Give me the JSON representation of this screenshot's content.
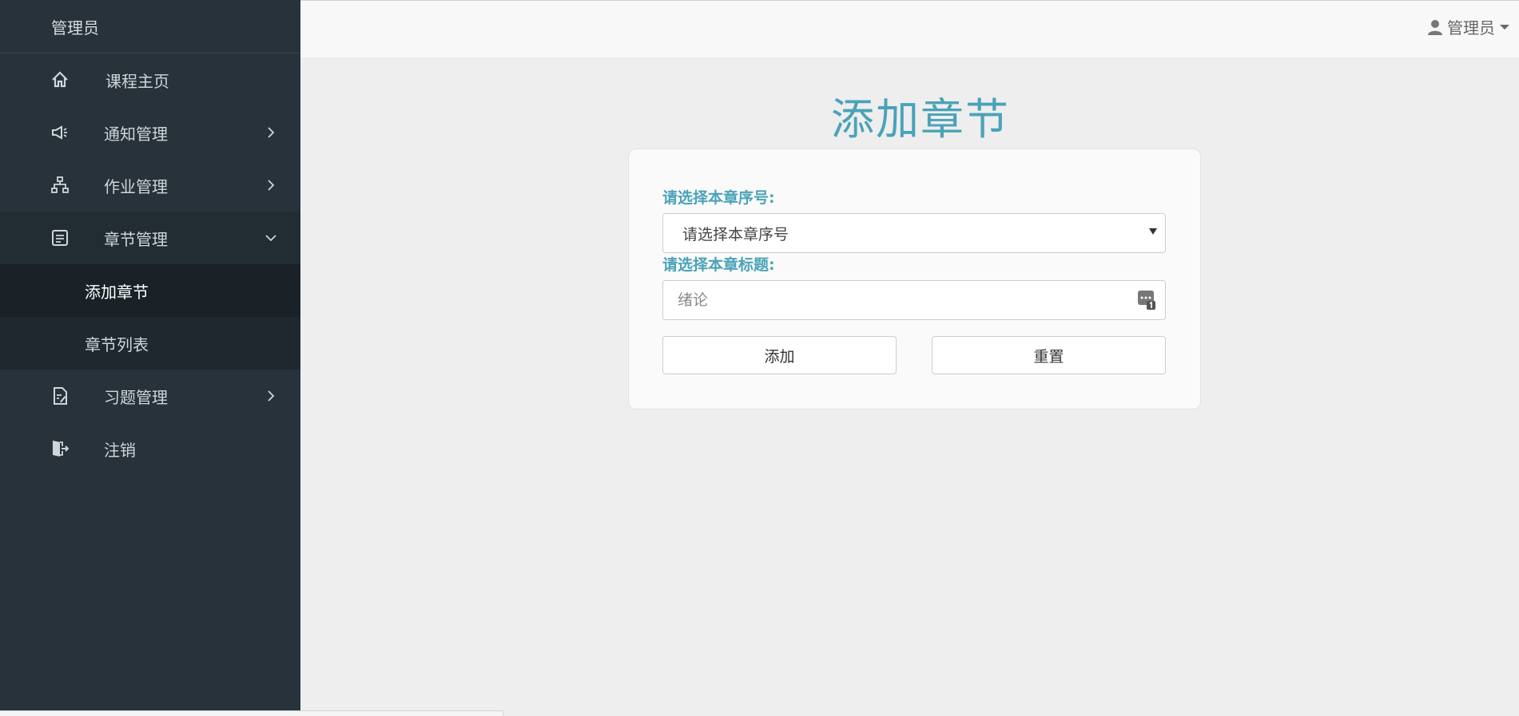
{
  "sidebar": {
    "brand": "管理员",
    "items": [
      {
        "label": "课程主页",
        "icon": "home-icon"
      },
      {
        "label": "通知管理",
        "icon": "megaphone-icon"
      },
      {
        "label": "作业管理",
        "icon": "sitemap-icon"
      },
      {
        "label": "章节管理",
        "icon": "document-icon",
        "expanded": true,
        "children": [
          {
            "label": "添加章节",
            "active": true
          },
          {
            "label": "章节列表"
          }
        ]
      },
      {
        "label": "习题管理",
        "icon": "edit-document-icon"
      },
      {
        "label": "注销",
        "icon": "logout-icon"
      }
    ]
  },
  "topbar": {
    "user_label": "管理员"
  },
  "main": {
    "title": "添加章节",
    "form": {
      "chapter_no_label": "请选择本章序号:",
      "chapter_no_select_value": "请选择本章序号",
      "chapter_title_label": "请选择本章标题:",
      "chapter_title_placeholder": "绪论",
      "add_button": "添加",
      "reset_button": "重置"
    }
  },
  "colors": {
    "sidebar_bg": "#27323a",
    "accent": "#4aa3b8",
    "page_bg": "#eeeeee"
  }
}
